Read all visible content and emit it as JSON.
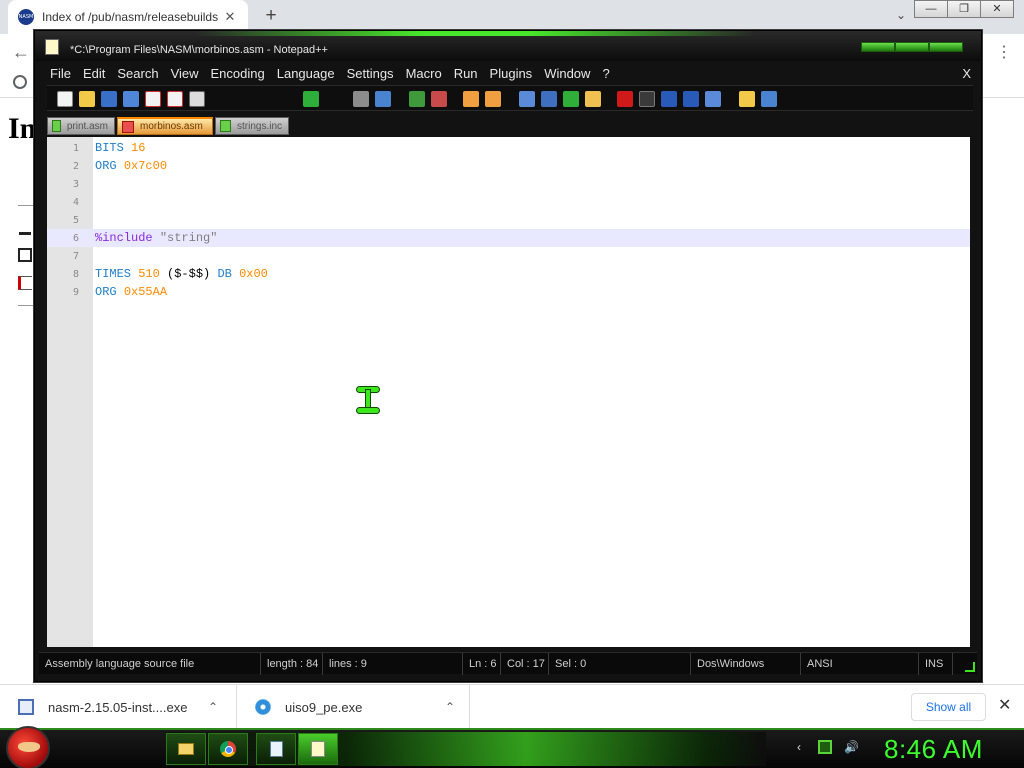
{
  "browser": {
    "tab_title": "Index of /pub/nasm/releasebuilds",
    "favicon_text": "NASM",
    "tab_close": "✕",
    "new_tab": "+",
    "tab_search": "⌄",
    "back": "←",
    "menu": "⋮",
    "page_heading": "In",
    "win_buttons": [
      "—",
      "❐",
      "✕"
    ]
  },
  "notepad": {
    "title": "*C:\\Program Files\\NASM\\morbinos.asm - Notepad++",
    "menu": [
      "File",
      "Edit",
      "Search",
      "View",
      "Encoding",
      "Language",
      "Settings",
      "Macro",
      "Run",
      "Plugins",
      "Window",
      "?"
    ],
    "menu_close": "X",
    "tabs": [
      {
        "label": "print.asm",
        "active": false,
        "unsaved": false
      },
      {
        "label": "morbinos.asm",
        "active": true,
        "unsaved": true
      },
      {
        "label": "strings.inc",
        "active": false,
        "unsaved": false
      }
    ],
    "lines": [
      {
        "n": "1",
        "tokens": [
          [
            "kw",
            "BITS"
          ],
          [
            "txt",
            " "
          ],
          [
            "num",
            "16"
          ]
        ]
      },
      {
        "n": "2",
        "tokens": [
          [
            "kw",
            "ORG"
          ],
          [
            "txt",
            " "
          ],
          [
            "num",
            "0x7c00"
          ]
        ]
      },
      {
        "n": "3",
        "tokens": []
      },
      {
        "n": "4",
        "tokens": []
      },
      {
        "n": "5",
        "tokens": []
      },
      {
        "n": "6",
        "tokens": [
          [
            "pp",
            "%include"
          ],
          [
            "txt",
            " "
          ],
          [
            "str",
            "\"string\""
          ]
        ],
        "current": true
      },
      {
        "n": "7",
        "tokens": []
      },
      {
        "n": "8",
        "tokens": [
          [
            "kw",
            "TIMES"
          ],
          [
            "txt",
            " "
          ],
          [
            "num",
            "510"
          ],
          [
            "txt",
            " "
          ],
          [
            "op",
            "($-$$)"
          ],
          [
            "txt",
            " "
          ],
          [
            "kw",
            "DB"
          ],
          [
            "txt",
            " "
          ],
          [
            "num",
            "0x00"
          ]
        ]
      },
      {
        "n": "9",
        "tokens": [
          [
            "kw",
            "ORG"
          ],
          [
            "txt",
            " "
          ],
          [
            "num",
            "0x55AA"
          ]
        ]
      }
    ],
    "status": {
      "file_type": "Assembly language source file",
      "length": "length : 84",
      "lines": "lines : 9",
      "ln": "Ln : 6",
      "col": "Col : 17",
      "sel": "Sel : 0",
      "eol": "Dos\\Windows",
      "encoding": "ANSI",
      "mode": "INS"
    }
  },
  "downloads": {
    "items": [
      {
        "name": "nasm-2.15.05-inst....exe",
        "chevron": "⌃"
      },
      {
        "name": "uiso9_pe.exe",
        "chevron": "⌃"
      }
    ],
    "show_all": "Show all",
    "close": "✕"
  },
  "taskbar": {
    "clock": "8:46 AM",
    "tray_arrow": "‹",
    "tray_volume": "🔊"
  },
  "colors": {
    "accent_green": "#3cff2e",
    "asm_keyword": "#1f7ec9",
    "asm_number": "#ff8a00",
    "current_line": "#e8e8ff"
  }
}
